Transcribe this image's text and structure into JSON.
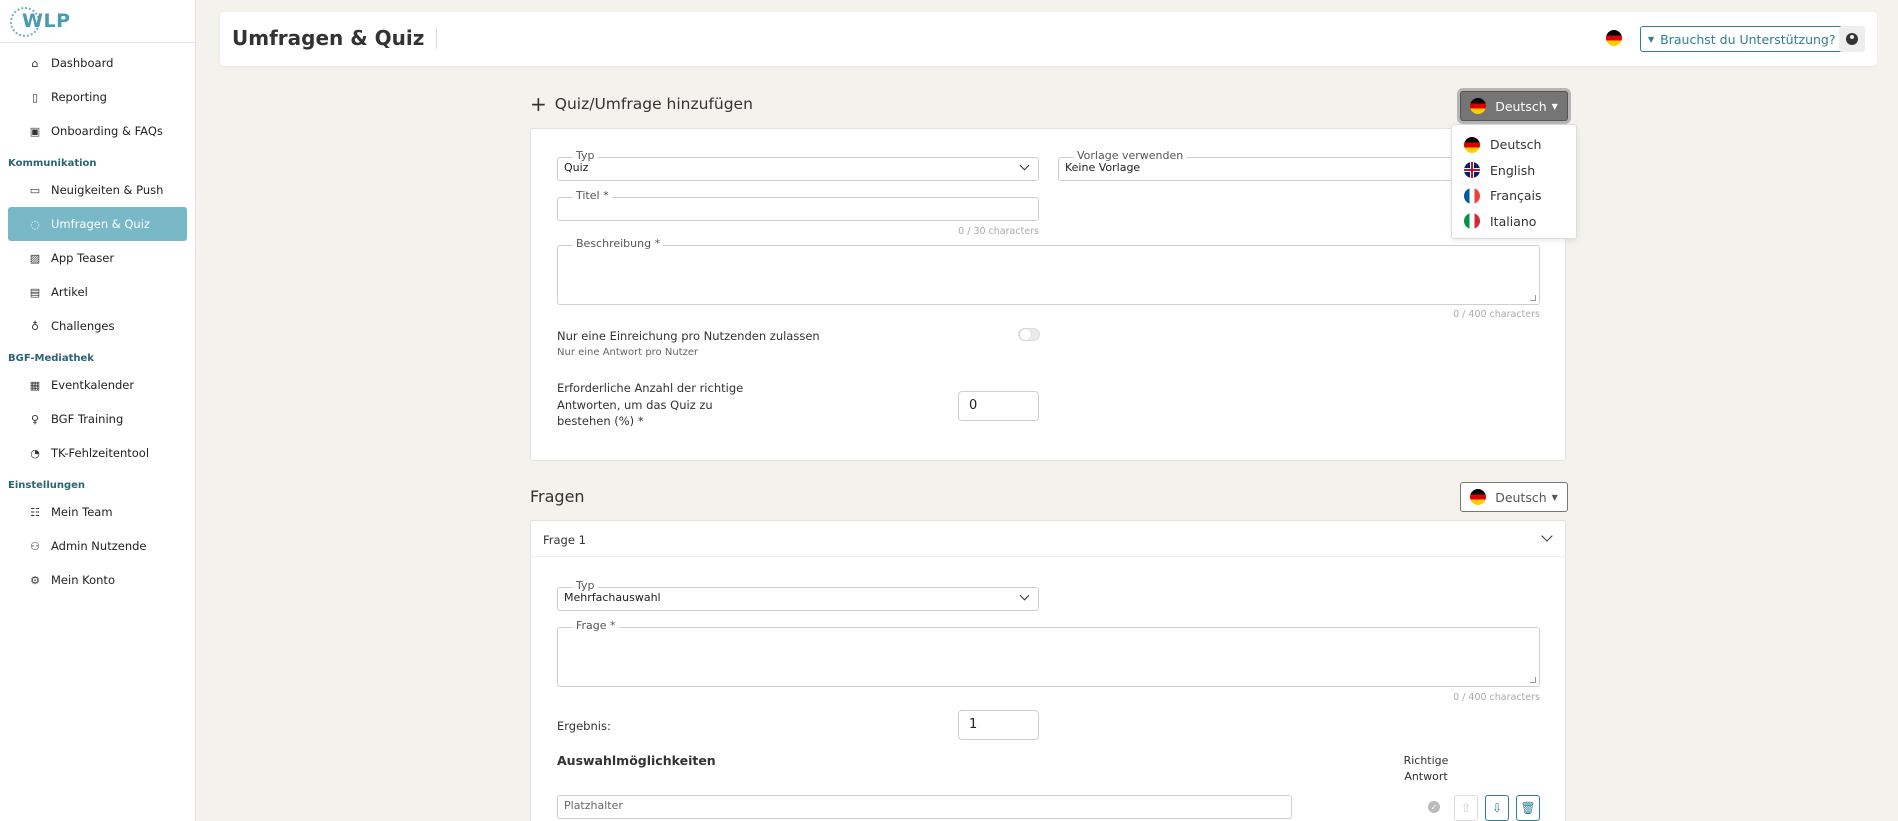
{
  "app": {
    "logo_text": "WLP"
  },
  "sidebar": {
    "items_top": [
      {
        "label": "Dashboard",
        "icon": "home-icon"
      },
      {
        "label": "Reporting",
        "icon": "document-icon"
      },
      {
        "label": "Onboarding & FAQs",
        "icon": "question-icon"
      }
    ],
    "section_kommunikation": "Kommunikation",
    "items_kommunikation": [
      {
        "label": "Neuigkeiten & Push",
        "icon": "chat-icon"
      },
      {
        "label": "Umfragen & Quiz",
        "icon": "speech-bubbles-icon",
        "active": true
      },
      {
        "label": "App Teaser",
        "icon": "image-icon"
      },
      {
        "label": "Artikel",
        "icon": "newspaper-icon"
      },
      {
        "label": "Challenges",
        "icon": "medal-icon"
      }
    ],
    "section_mediathek": "BGF-Mediathek",
    "items_mediathek": [
      {
        "label": "Eventkalender",
        "icon": "calendar-icon"
      },
      {
        "label": "BGF Training",
        "icon": "lightbulb-icon"
      },
      {
        "label": "TK-Fehlzeitentool",
        "icon": "chart-pie-icon"
      }
    ],
    "section_einstellungen": "Einstellungen",
    "items_einstellungen": [
      {
        "label": "Mein Team",
        "icon": "team-icon"
      },
      {
        "label": "Admin Nutzende",
        "icon": "user-gear-icon"
      },
      {
        "label": "Mein Konto",
        "icon": "gear-icon"
      }
    ]
  },
  "header": {
    "title": "Umfragen & Quiz",
    "help_label": "Brauchst du Unterstützung?"
  },
  "quiz_form": {
    "heading": "Quiz/Umfrage hinzufügen",
    "language_button": "Deutsch",
    "language_options": [
      "Deutsch",
      "English",
      "Français",
      "Italiano"
    ],
    "type_label": "Typ",
    "type_value": "Quiz",
    "template_label": "Vorlage verwenden",
    "template_value": "Keine Vorlage",
    "title_label": "Titel *",
    "title_counter": "0 / 30 characters",
    "description_label": "Beschreibung *",
    "description_counter": "0 / 400 characters",
    "single_submission_label": "Nur eine Einreichung pro Nutzenden zulassen",
    "single_submission_hint": "Nur eine Antwort pro Nutzer",
    "pass_label_1": "Erforderliche Anzahl der richtige",
    "pass_label_2": "Antworten, um das Quiz zu",
    "pass_label_3": "bestehen (%) *",
    "pass_value": "0"
  },
  "questions": {
    "heading": "Fragen",
    "language_button": "Deutsch",
    "item_title": "Frage 1",
    "type_label": "Typ",
    "type_value": "Mehrfachauswahl",
    "question_label": "Frage *",
    "question_counter": "0 / 400 characters",
    "result_label": "Ergebnis:",
    "result_value": "1",
    "choices_heading": "Auswahlmöglichkeiten",
    "correct_answer_1": "Richtige",
    "correct_answer_2": "Antwort",
    "choice_placeholder": "Platzhalter"
  },
  "colors": {
    "accent": "#2e7f93",
    "active_nav": "#78b8c7",
    "background": "#f4f2ed"
  }
}
